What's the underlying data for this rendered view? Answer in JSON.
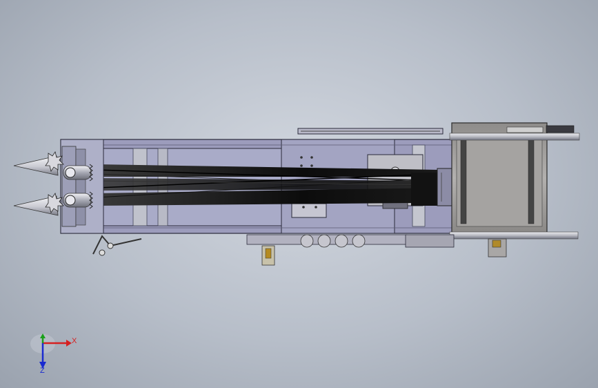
{
  "viewport": {
    "background_top": "#d2d7df",
    "background_bottom": "#9aa2ae"
  },
  "model": {
    "frame_color": "#9c9cbc",
    "frame_edge": "#2a2a3a",
    "belt_color": "#111111",
    "housing_color": "#a9a7a6",
    "roller_color": "#c9cbd4"
  },
  "triad": {
    "x_label": "X",
    "z_label": "Z",
    "x_color": "#d62020",
    "y_color": "#1aa01a",
    "z_color": "#1a2ad0",
    "icons": [
      "triad-x-arrow-icon",
      "triad-y-axis-icon",
      "triad-z-arrow-icon"
    ]
  }
}
